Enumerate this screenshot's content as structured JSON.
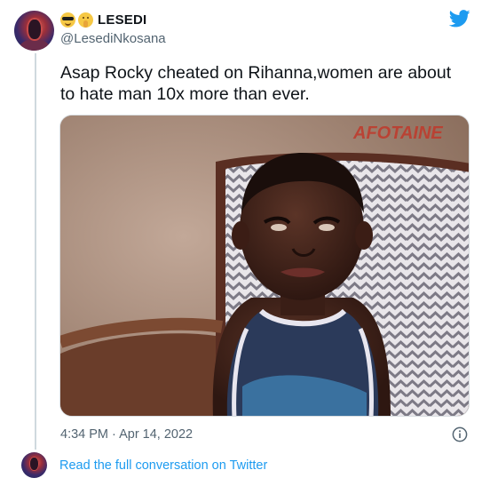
{
  "user": {
    "emoji_1": "sunglasses-emoji",
    "emoji_2": "shushing-face-emoji",
    "display_name": "LESEDI",
    "handle": "@LesediNkosana"
  },
  "tweet": {
    "text": "Asap Rocky cheated on Rihanna,women are about to hate man 10x more than ever.",
    "media_watermark": "AFOTAINE",
    "timestamp": "4:34 PM · Apr 14, 2022"
  },
  "footer": {
    "read_link": "Read the full conversation on Twitter"
  },
  "colors": {
    "link": "#1d9bf0",
    "text": "#0f1419",
    "secondary": "#536471"
  }
}
